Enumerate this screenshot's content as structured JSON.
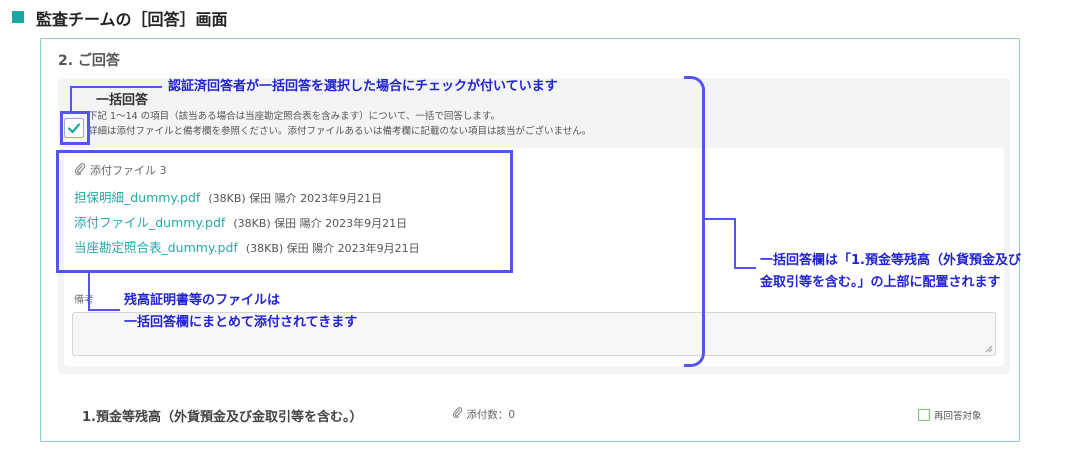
{
  "header": {
    "title": "監査チームの［回答］画面"
  },
  "section": {
    "title": "2. ご回答"
  },
  "bulk": {
    "title": "一括回答",
    "checked": true,
    "desc_line1": "下記 1〜14 の項目（該当ある場合は当座勘定照合表を含みます）について、一括で回答します。",
    "desc_line2": "詳細は添付ファイルと備考欄を参照ください。添付ファイルあるいは備考欄に記載のない項目は該当がございません。",
    "attachments_label": "添付ファイル 3",
    "files": [
      {
        "name": "担保明細_dummy.pdf",
        "meta": "(38KB)  保田 陽介  2023年9月21日"
      },
      {
        "name": "添付ファイル_dummy.pdf",
        "meta": "(38KB)  保田 陽介  2023年9月21日"
      },
      {
        "name": "当座勘定照合表_dummy.pdf",
        "meta": "(38KB)  保田 陽介  2023年9月21日"
      }
    ],
    "memo_label": "備考",
    "memo_value": ""
  },
  "question": {
    "title": "1.預金等残高（外貨預金及び金取引等を含む。）",
    "attach_count": "添付数：0",
    "re_answer_label": "再回答対象"
  },
  "annotations": {
    "check_note": "認証済回答者が一括回答を選択した場合にチェックが付いています",
    "files_note_line1": "残高証明書等のファイルは",
    "files_note_line2": "一括回答欄にまとめて添付されてきます",
    "position_note_line1": "一括回答欄は「1.預金等残高（外貨預金及び",
    "position_note_line2": "金取引等を含む。」の上部に配置されます"
  },
  "colors": {
    "accent": "#1aa7a0",
    "link": "#2aa6a6",
    "annotation": "#2323d6",
    "highlight": "#5555ee"
  }
}
